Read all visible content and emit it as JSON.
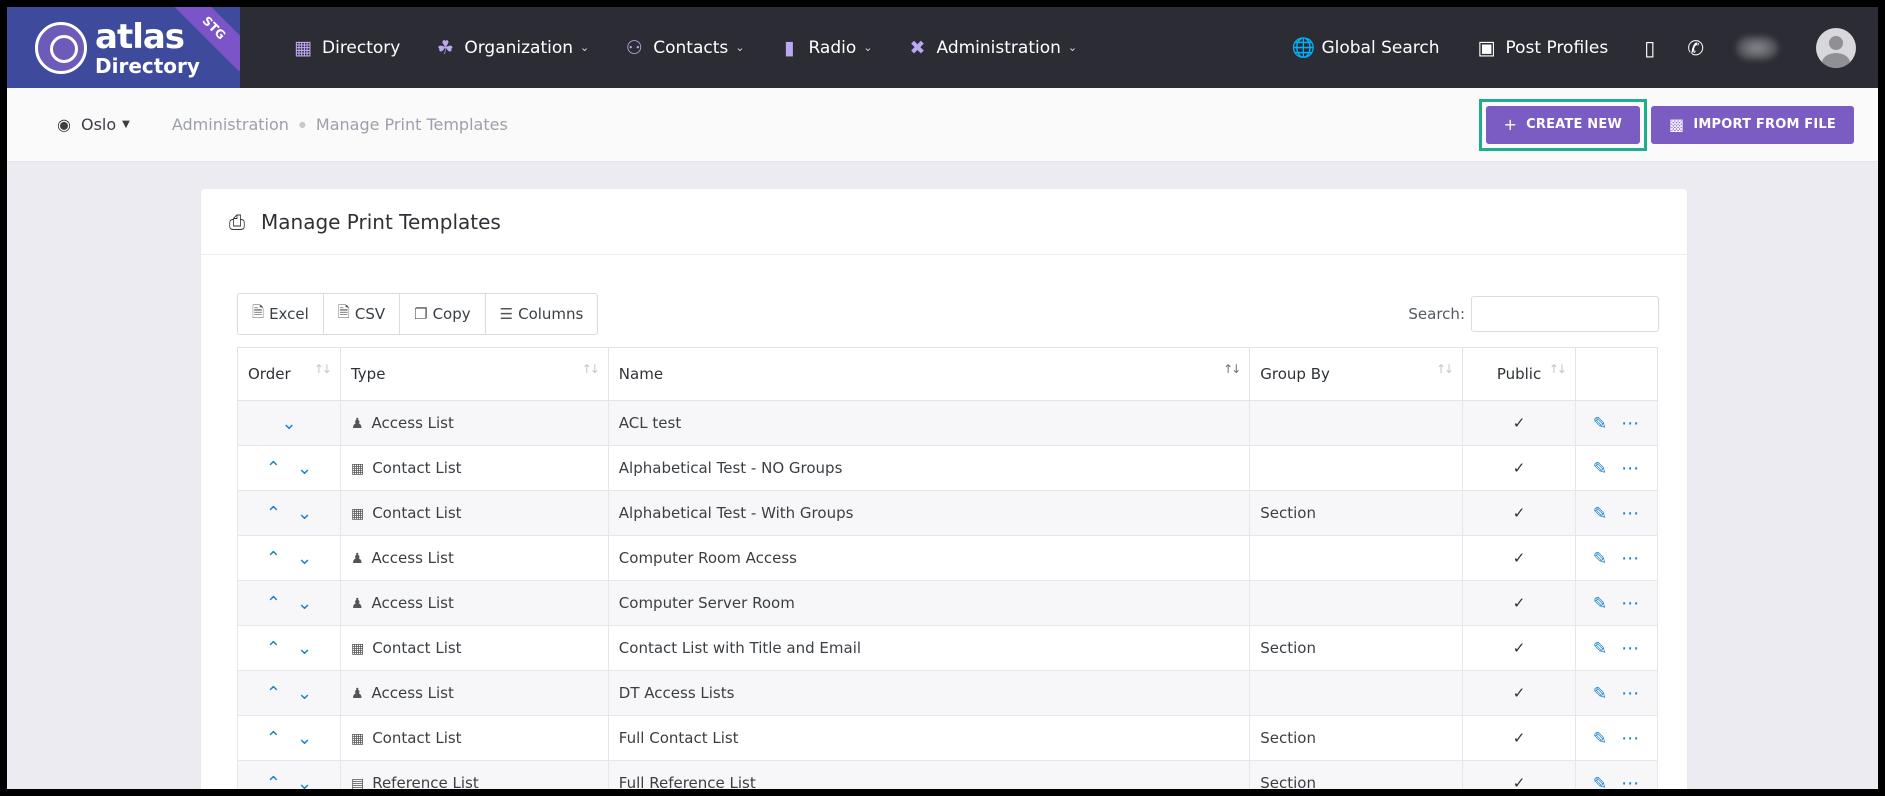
{
  "brand": {
    "line1": "atlas",
    "line2": "Directory",
    "env_badge": "STG"
  },
  "nav": {
    "items": [
      {
        "label": "Directory",
        "icon": "directory-icon"
      },
      {
        "label": "Organization",
        "icon": "organization-icon",
        "has_dropdown": true
      },
      {
        "label": "Contacts",
        "icon": "contacts-icon",
        "has_dropdown": true
      },
      {
        "label": "Radio",
        "icon": "radio-icon",
        "has_dropdown": true
      },
      {
        "label": "Administration",
        "icon": "tools-icon",
        "has_dropdown": true
      }
    ],
    "right_items": [
      {
        "label": "Global Search",
        "icon": "globe-search-icon"
      },
      {
        "label": "Post Profiles",
        "icon": "profile-book-icon"
      }
    ],
    "icons": [
      "walkie-talkie-icon",
      "phone-signal-icon",
      "blurred-avatar",
      "user-avatar"
    ]
  },
  "subheader": {
    "location": "Oslo",
    "breadcrumb": [
      "Administration",
      "Manage Print Templates"
    ],
    "create_button": "CREATE NEW",
    "import_button": "IMPORT FROM FILE",
    "highlight_color": "#1fae8d"
  },
  "card": {
    "title": "Manage Print Templates",
    "toolbar": [
      "Excel",
      "CSV",
      "Copy",
      "Columns"
    ],
    "search_label": "Search:",
    "search_value": "",
    "columns": [
      "Order",
      "Type",
      "Name",
      "Group By",
      "Public",
      ""
    ],
    "rows": [
      {
        "type": "Access List",
        "type_icon": "users-icon",
        "name": "ACL test",
        "group_by": "",
        "public": "✓",
        "up": false,
        "down": true
      },
      {
        "type": "Contact List",
        "type_icon": "table-icon",
        "name": "Alphabetical Test - NO Groups",
        "group_by": "",
        "public": "✓",
        "up": true,
        "down": true
      },
      {
        "type": "Contact List",
        "type_icon": "table-icon",
        "name": "Alphabetical Test - With Groups",
        "group_by": "Section",
        "public": "✓",
        "up": true,
        "down": true
      },
      {
        "type": "Access List",
        "type_icon": "users-icon",
        "name": "Computer Room Access",
        "group_by": "",
        "public": "✓",
        "up": true,
        "down": true
      },
      {
        "type": "Access List",
        "type_icon": "users-icon",
        "name": "Computer Server Room",
        "group_by": "",
        "public": "✓",
        "up": true,
        "down": true
      },
      {
        "type": "Contact List",
        "type_icon": "table-icon",
        "name": "Contact List with Title and Email",
        "group_by": "Section",
        "public": "✓",
        "up": true,
        "down": true
      },
      {
        "type": "Access List",
        "type_icon": "users-icon",
        "name": "DT Access Lists",
        "group_by": "",
        "public": "✓",
        "up": true,
        "down": true
      },
      {
        "type": "Contact List",
        "type_icon": "table-icon",
        "name": "Full Contact List",
        "group_by": "Section",
        "public": "✓",
        "up": true,
        "down": true
      },
      {
        "type": "Reference List",
        "type_icon": "document-icon",
        "name": "Full Reference List",
        "group_by": "Section",
        "public": "✓",
        "up": true,
        "down": true
      }
    ]
  },
  "colors": {
    "topbar": "#2c2c34",
    "logo_bg": "#3e4b9c",
    "accent": "#7b5cc2",
    "link_blue": "#1e84c8"
  }
}
